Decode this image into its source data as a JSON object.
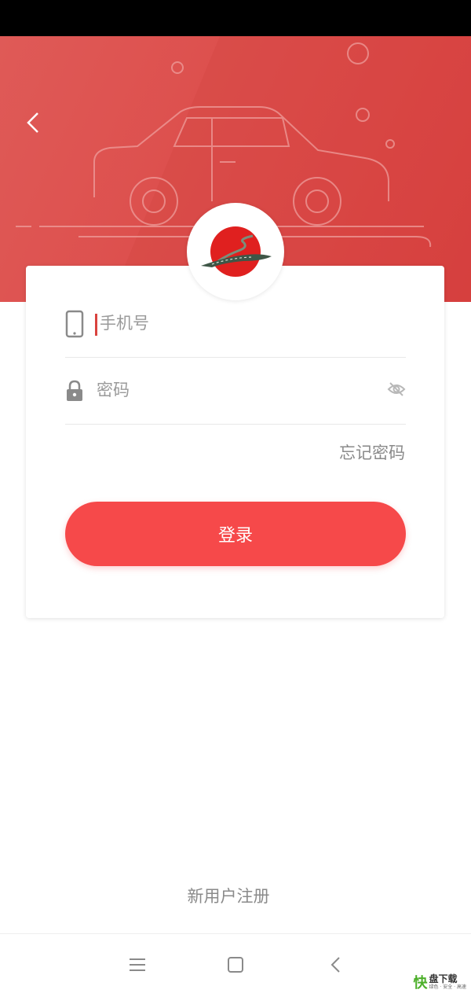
{
  "header": {
    "back_icon": "chevron-left-icon"
  },
  "logo": {
    "icon": "road-logo-icon"
  },
  "form": {
    "phone": {
      "icon": "phone-icon",
      "placeholder": "手机号",
      "value": ""
    },
    "password": {
      "icon": "lock-icon",
      "placeholder": "密码",
      "value": "",
      "visibility_icon": "eye-off-icon"
    },
    "forgot_label": "忘记密码",
    "login_label": "登录"
  },
  "register_label": "新用户注册",
  "nav": {
    "menu_icon": "menu-icon",
    "home_icon": "square-home-icon",
    "back_icon": "triangle-back-icon"
  },
  "watermark": {
    "mark": "快",
    "main": "盘下载",
    "sub": "绿色 · 安全 · 高速"
  },
  "colors": {
    "brand_red": "#dc4c4a",
    "button_red": "#f6494a",
    "caret": "#d9433f"
  }
}
